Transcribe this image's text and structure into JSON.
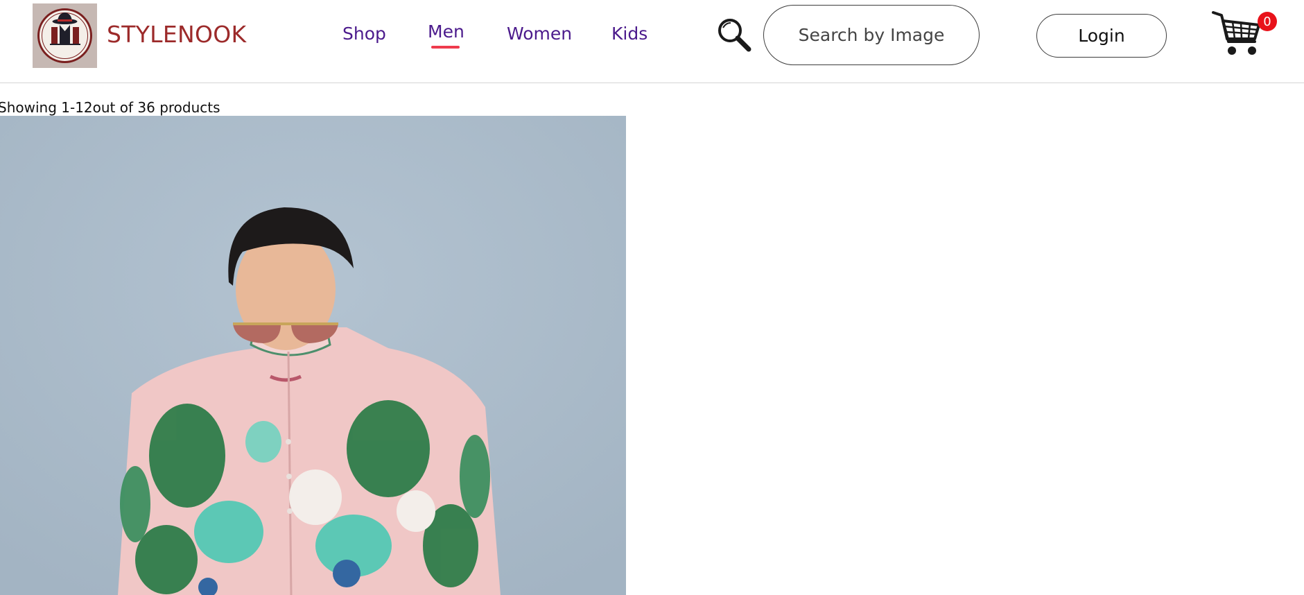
{
  "brand": {
    "name": "STYLENOOK",
    "logo_text": "STYLENOOK",
    "logo_icon": "hat-storefront-emblem"
  },
  "nav": {
    "items": [
      {
        "label": "Shop",
        "active": false
      },
      {
        "label": "Men",
        "active": true
      },
      {
        "label": "Women",
        "active": false
      },
      {
        "label": "Kids",
        "active": false
      }
    ]
  },
  "header": {
    "search_icon": "magnifier-icon",
    "search_by_image_label": "Search by Image",
    "login_label": "Login",
    "cart_icon": "shopping-cart-icon",
    "cart_count": "0"
  },
  "listing": {
    "results_text": "Showing 1-12out of 36 products",
    "products": [
      {
        "image_alt": "Man in sunglasses wearing printed kurta with peacock and tree motifs"
      }
    ]
  },
  "colors": {
    "brand": "#9c2a2a",
    "nav_text": "#4b1a8c",
    "active_underline": "#ef3b4d",
    "cart_badge": "#e8121a",
    "photo_background": "#a9bac9"
  }
}
